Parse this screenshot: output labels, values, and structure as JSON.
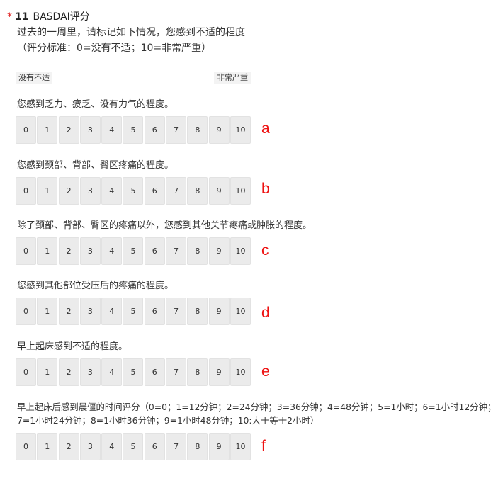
{
  "question": {
    "required_mark": "*",
    "number": "11",
    "title": "BASDAI评分",
    "instruction": "过去的一周里，请标记如下情况，您感到不适的程度",
    "scale_note": "（评分标准：0=没有不适；10=非常严重）",
    "low_label": "没有不适",
    "high_label": "非常严重"
  },
  "items": [
    {
      "text": "您感到乏力、疲乏、没有力气的程度。",
      "letter": "a",
      "options": [
        "0",
        "1",
        "2",
        "3",
        "4",
        "5",
        "6",
        "7",
        "8",
        "9",
        "10"
      ]
    },
    {
      "text": "您感到颈部、背部、臀区疼痛的程度。",
      "letter": "b",
      "options": [
        "0",
        "1",
        "2",
        "3",
        "4",
        "5",
        "6",
        "7",
        "8",
        "9",
        "10"
      ]
    },
    {
      "text": "除了颈部、背部、臀区的疼痛以外，您感到其他关节疼痛或肿胀的程度。",
      "letter": "c",
      "options": [
        "0",
        "1",
        "2",
        "3",
        "4",
        "5",
        "6",
        "7",
        "8",
        "9",
        "10"
      ]
    },
    {
      "text": "您感到其他部位受压后的疼痛的程度。",
      "letter": "d",
      "options": [
        "0",
        "1",
        "2",
        "3",
        "4",
        "5",
        "6",
        "7",
        "8",
        "9",
        "10"
      ]
    },
    {
      "text": "早上起床感到不适的程度。",
      "letter": "e",
      "options": [
        "0",
        "1",
        "2",
        "3",
        "4",
        "5",
        "6",
        "7",
        "8",
        "9",
        "10"
      ]
    },
    {
      "text": "早上起床后感到晨僵的时间评分（0=0；1=12分钟；2=24分钟；3=36分钟；4=48分钟；5=1小时；6=1小时12分钟；",
      "text_line2": "7=1小时24分钟；8=1小时36分钟；9=1小时48分钟；10:大于等于2小时）",
      "letter": "f",
      "options": [
        "0",
        "1",
        "2",
        "3",
        "4",
        "5",
        "6",
        "7",
        "8",
        "9",
        "10"
      ]
    }
  ]
}
